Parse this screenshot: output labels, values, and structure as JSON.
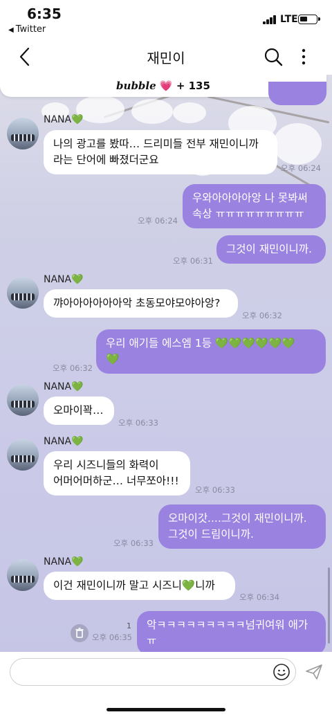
{
  "status_bar": {
    "time": "6:35",
    "back_app": "Twitter",
    "network": "LTE"
  },
  "header": {
    "title": "재민이"
  },
  "banner": {
    "brand": "bubble",
    "count": "+ 135"
  },
  "messages": [
    {
      "sender": "NANA",
      "text": "나의 광고를 봤따… 드리미들 전부 재민이니까\n라는 단어에 빠졌더군요",
      "time": "오후 06:24"
    },
    {
      "text": "우와아아아아앙 나 못봐써\n속상 ㅠㅠㅠㅠㅠㅠㅠㅠㅠ",
      "time": "오후 06:24"
    },
    {
      "text": "그것이 재민이니까.",
      "time": "오후 06:31"
    },
    {
      "sender": "NANA",
      "text": "꺄아아아아아아악 초동모야모야아앙?",
      "time": "오후 06:32"
    },
    {
      "text": "우리 애기들 에스엠 1등",
      "time": "오후 06:32"
    },
    {
      "sender": "NANA",
      "text": "오마이꽉…",
      "time": "오후 06:33"
    },
    {
      "sender": "NANA",
      "text": "우리 시즈니들의 화력이\n어머어머하군… 너무쪼아!!!",
      "time": "오후 06:33"
    },
    {
      "text": "오마이갓....그것이 재민이니까.\n그것이 드림이니까.",
      "time": "오후 06:33"
    },
    {
      "sender": "NANA",
      "text_before": "이건 재민이니까 말고 시즈니",
      "text_after": "니까",
      "time": "오후 06:34"
    },
    {
      "text": "악ㅋㅋㅋㅋㅋㅋㅋㅋㅋ넘귀여워 애가ㅠ",
      "time": "오후 06:35",
      "unread": "1"
    }
  ],
  "emoji": {
    "green_heart": "💚",
    "green_hearts_row1": "💚💚💚💚💚💚",
    "pink_heart": "💗"
  },
  "composer": {
    "placeholder": ""
  },
  "colors": {
    "outgoing_bubble": "#9a82e0",
    "incoming_bubble": "#ffffff",
    "green_heart": "#35c21a"
  }
}
